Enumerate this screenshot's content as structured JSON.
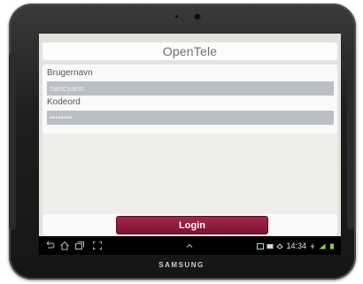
{
  "device": {
    "brand_text": "SAMSUNG"
  },
  "app": {
    "title": "OpenTele"
  },
  "form": {
    "username_label": "Brugernavn",
    "username_value": "nancyann",
    "password_label": "Kodeord",
    "password_value": "••••••••"
  },
  "actions": {
    "login_label": "Login"
  },
  "status_bar": {
    "time": "14:34",
    "icons": [
      "image-icon",
      "email-icon",
      "sync-icon",
      "usb-icon",
      "signal-icon",
      "battery-icon"
    ]
  },
  "nav_bar": {
    "icons": [
      "back-icon",
      "home-icon",
      "recent-apps-icon",
      "screenshot-icon",
      "up-chevron-icon"
    ]
  },
  "colors": {
    "accent": "#8a1a38",
    "screen_bg": "#e4e2dc",
    "input_bg": "#b9bfc6"
  }
}
